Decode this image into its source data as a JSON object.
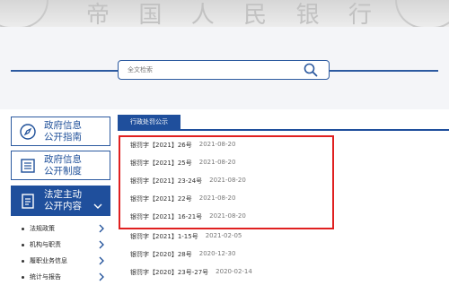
{
  "banner": {
    "watermark": [
      "帝",
      "国",
      "人",
      "民",
      "银",
      "行"
    ]
  },
  "search": {
    "placeholder": "全文检索",
    "icon": "search-icon"
  },
  "sidebar": {
    "buttons": [
      {
        "line1": "政府信息",
        "line2": "公开指南",
        "icon": "compass-icon"
      },
      {
        "line1": "政府信息",
        "line2": "公开制度",
        "icon": "document-list-icon"
      },
      {
        "line1": "法定主动",
        "line2": "公开内容",
        "icon": "clipboard-icon"
      }
    ],
    "subitems": [
      "法规政策",
      "机构与职责",
      "履职业务信息",
      "统计与报告"
    ]
  },
  "main": {
    "tab": "行政处罚公示",
    "rows": [
      {
        "title": "银罚字【2021】26号",
        "date": "2021-08-20"
      },
      {
        "title": "银罚字【2021】25号",
        "date": "2021-08-20"
      },
      {
        "title": "银罚字【2021】23-24号",
        "date": "2021-08-20"
      },
      {
        "title": "银罚字【2021】22号",
        "date": "2021-08-20"
      },
      {
        "title": "银罚字【2021】16-21号",
        "date": "2021-08-20"
      },
      {
        "title": "银罚字【2021】1-15号",
        "date": "2021-02-05"
      },
      {
        "title": "银罚字【2020】28号",
        "date": "2020-12-30"
      },
      {
        "title": "银罚字【2020】23号-27号",
        "date": "2020-02-14"
      }
    ]
  },
  "colors": {
    "primary": "#1f4f9c",
    "highlight": "#e02020"
  }
}
